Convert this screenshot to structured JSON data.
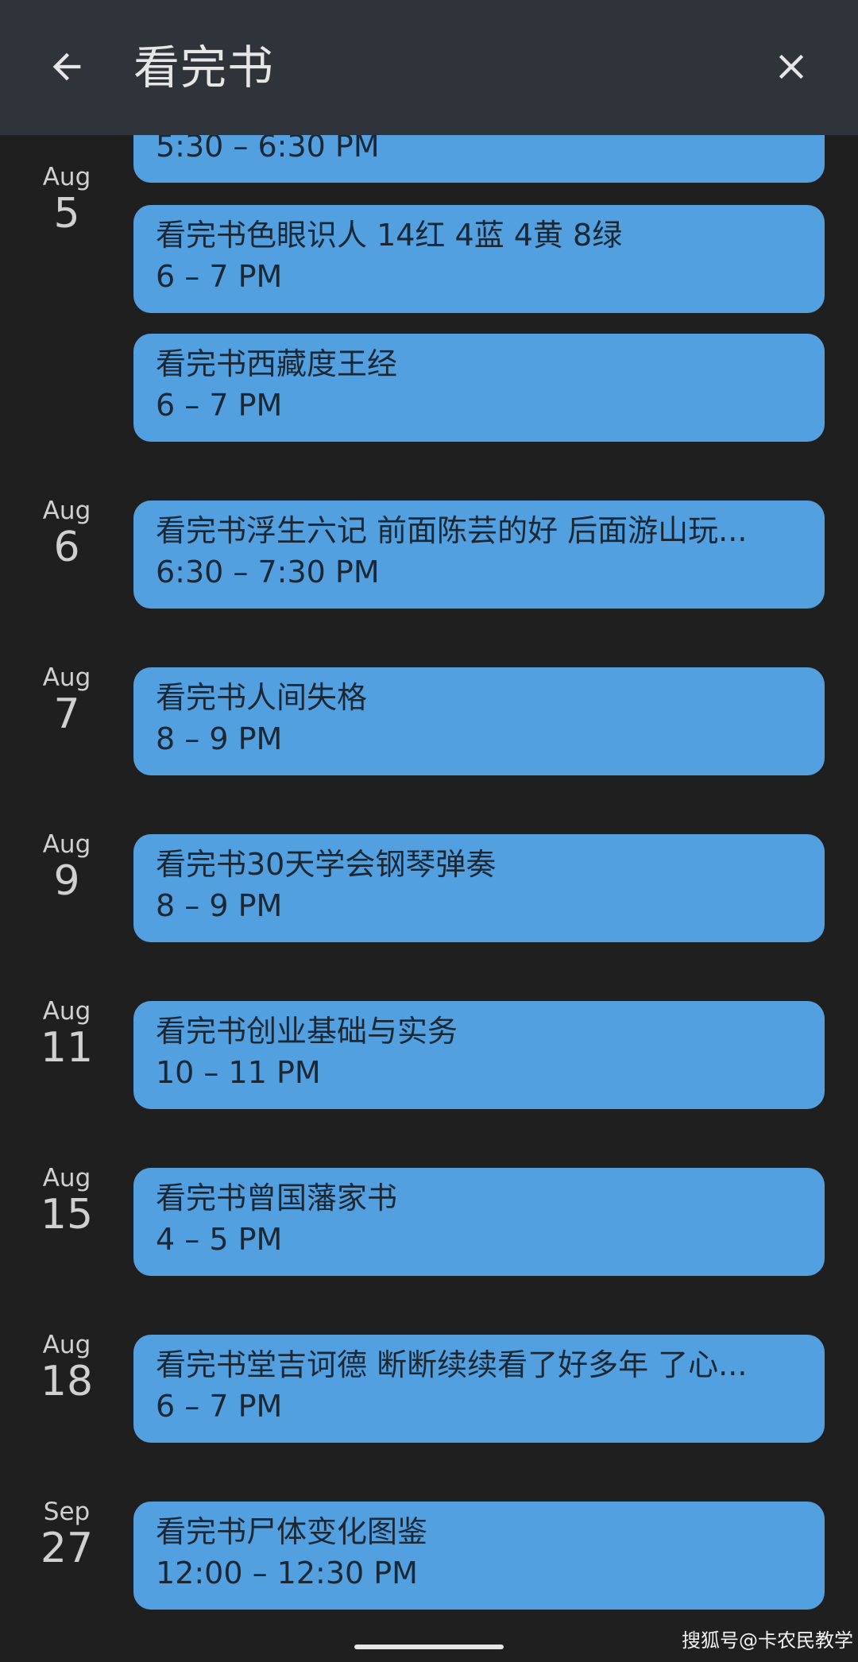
{
  "header": {
    "title": "看完书",
    "back_icon": "arrow-left-icon",
    "close_icon": "close-icon"
  },
  "partial_event": {
    "time": "5:30 – 6:30 PM"
  },
  "groups": [
    {
      "month": "Aug",
      "day": "5",
      "events": [
        {
          "title": "看完书色眼识人 14红 4蓝 4黄 8绿",
          "time": "6 – 7 PM"
        },
        {
          "title": "看完书西藏度王经",
          "time": "6 – 7 PM"
        }
      ]
    },
    {
      "month": "Aug",
      "day": "6",
      "events": [
        {
          "title": "看完书浮生六记 前面陈芸的好 后面游山玩...",
          "time": "6:30 – 7:30 PM"
        }
      ]
    },
    {
      "month": "Aug",
      "day": "7",
      "events": [
        {
          "title": "看完书人间失格",
          "time": "8 – 9 PM"
        }
      ]
    },
    {
      "month": "Aug",
      "day": "9",
      "events": [
        {
          "title": "看完书30天学会钢琴弹奏",
          "time": "8 – 9 PM"
        }
      ]
    },
    {
      "month": "Aug",
      "day": "11",
      "events": [
        {
          "title": "看完书创业基础与实务",
          "time": "10 – 11 PM"
        }
      ]
    },
    {
      "month": "Aug",
      "day": "15",
      "events": [
        {
          "title": "看完书曾国藩家书",
          "time": "4 – 5 PM"
        }
      ]
    },
    {
      "month": "Aug",
      "day": "18",
      "events": [
        {
          "title": "看完书堂吉诃德 断断续续看了好多年 了心...",
          "time": "6 – 7 PM"
        }
      ]
    },
    {
      "month": "Sep",
      "day": "27",
      "events": [
        {
          "title": "看完书尸体变化图鉴",
          "time": "12:00 – 12:30 PM"
        }
      ]
    }
  ],
  "watermark": "搜狐号@卡农民教学",
  "colors": {
    "background": "#1f1f1f",
    "header": "#2f333a",
    "event_chip": "#52a0e0",
    "event_text": "#1b2732",
    "date_text": "#d0d0d0"
  }
}
